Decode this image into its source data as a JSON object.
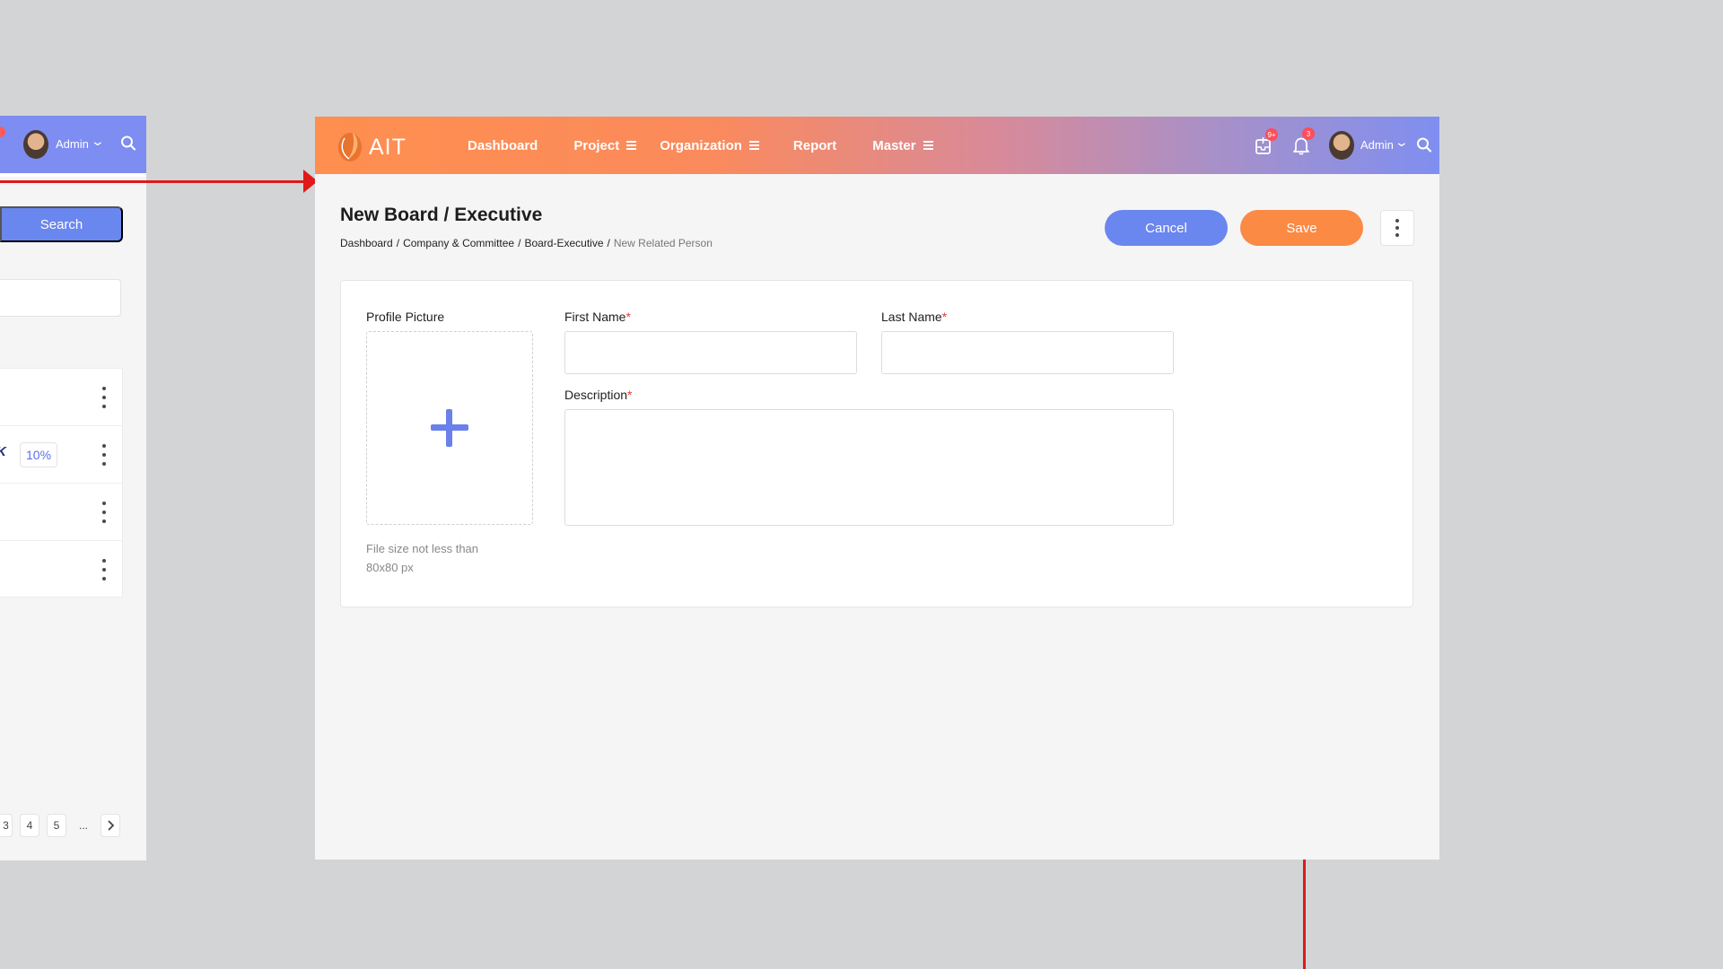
{
  "left_panel": {
    "user_name": "Admin",
    "search_button_label": "Search",
    "rows": [
      {
        "brand": "",
        "percent": ""
      },
      {
        "brand": "K",
        "percent": "10%"
      },
      {
        "brand": "",
        "percent": ""
      },
      {
        "brand": "",
        "percent": ""
      }
    ],
    "pagination": [
      "3",
      "4",
      "5",
      "..."
    ]
  },
  "app": {
    "logo_text": "AIT",
    "nav": [
      {
        "label": "Dashboard",
        "has_menu": false
      },
      {
        "label": "Project",
        "has_menu": true
      },
      {
        "label": "Organization",
        "has_menu": true
      },
      {
        "label": "Report",
        "has_menu": false
      },
      {
        "label": "Master",
        "has_menu": true
      }
    ],
    "inbox_badge": "9+",
    "notification_badge": "3",
    "user_name": "Admin"
  },
  "page": {
    "title": "New Board / Executive",
    "breadcrumb": [
      "Dashboard",
      "Company & Committee",
      "Board-Executive",
      "New Related Person"
    ],
    "cancel_label": "Cancel",
    "save_label": "Save"
  },
  "form": {
    "profile_picture_label": "Profile Picture",
    "profile_hint": "File size not less than 80x80 px",
    "first_name_label": "First Name",
    "last_name_label": "Last Name",
    "description_label": "Description",
    "required_mark": "*",
    "first_name_value": "",
    "last_name_value": "",
    "description_value": ""
  },
  "colors": {
    "accent_blue": "#6a86ef",
    "accent_orange": "#fb8a45",
    "annotation_red": "#e01919"
  }
}
